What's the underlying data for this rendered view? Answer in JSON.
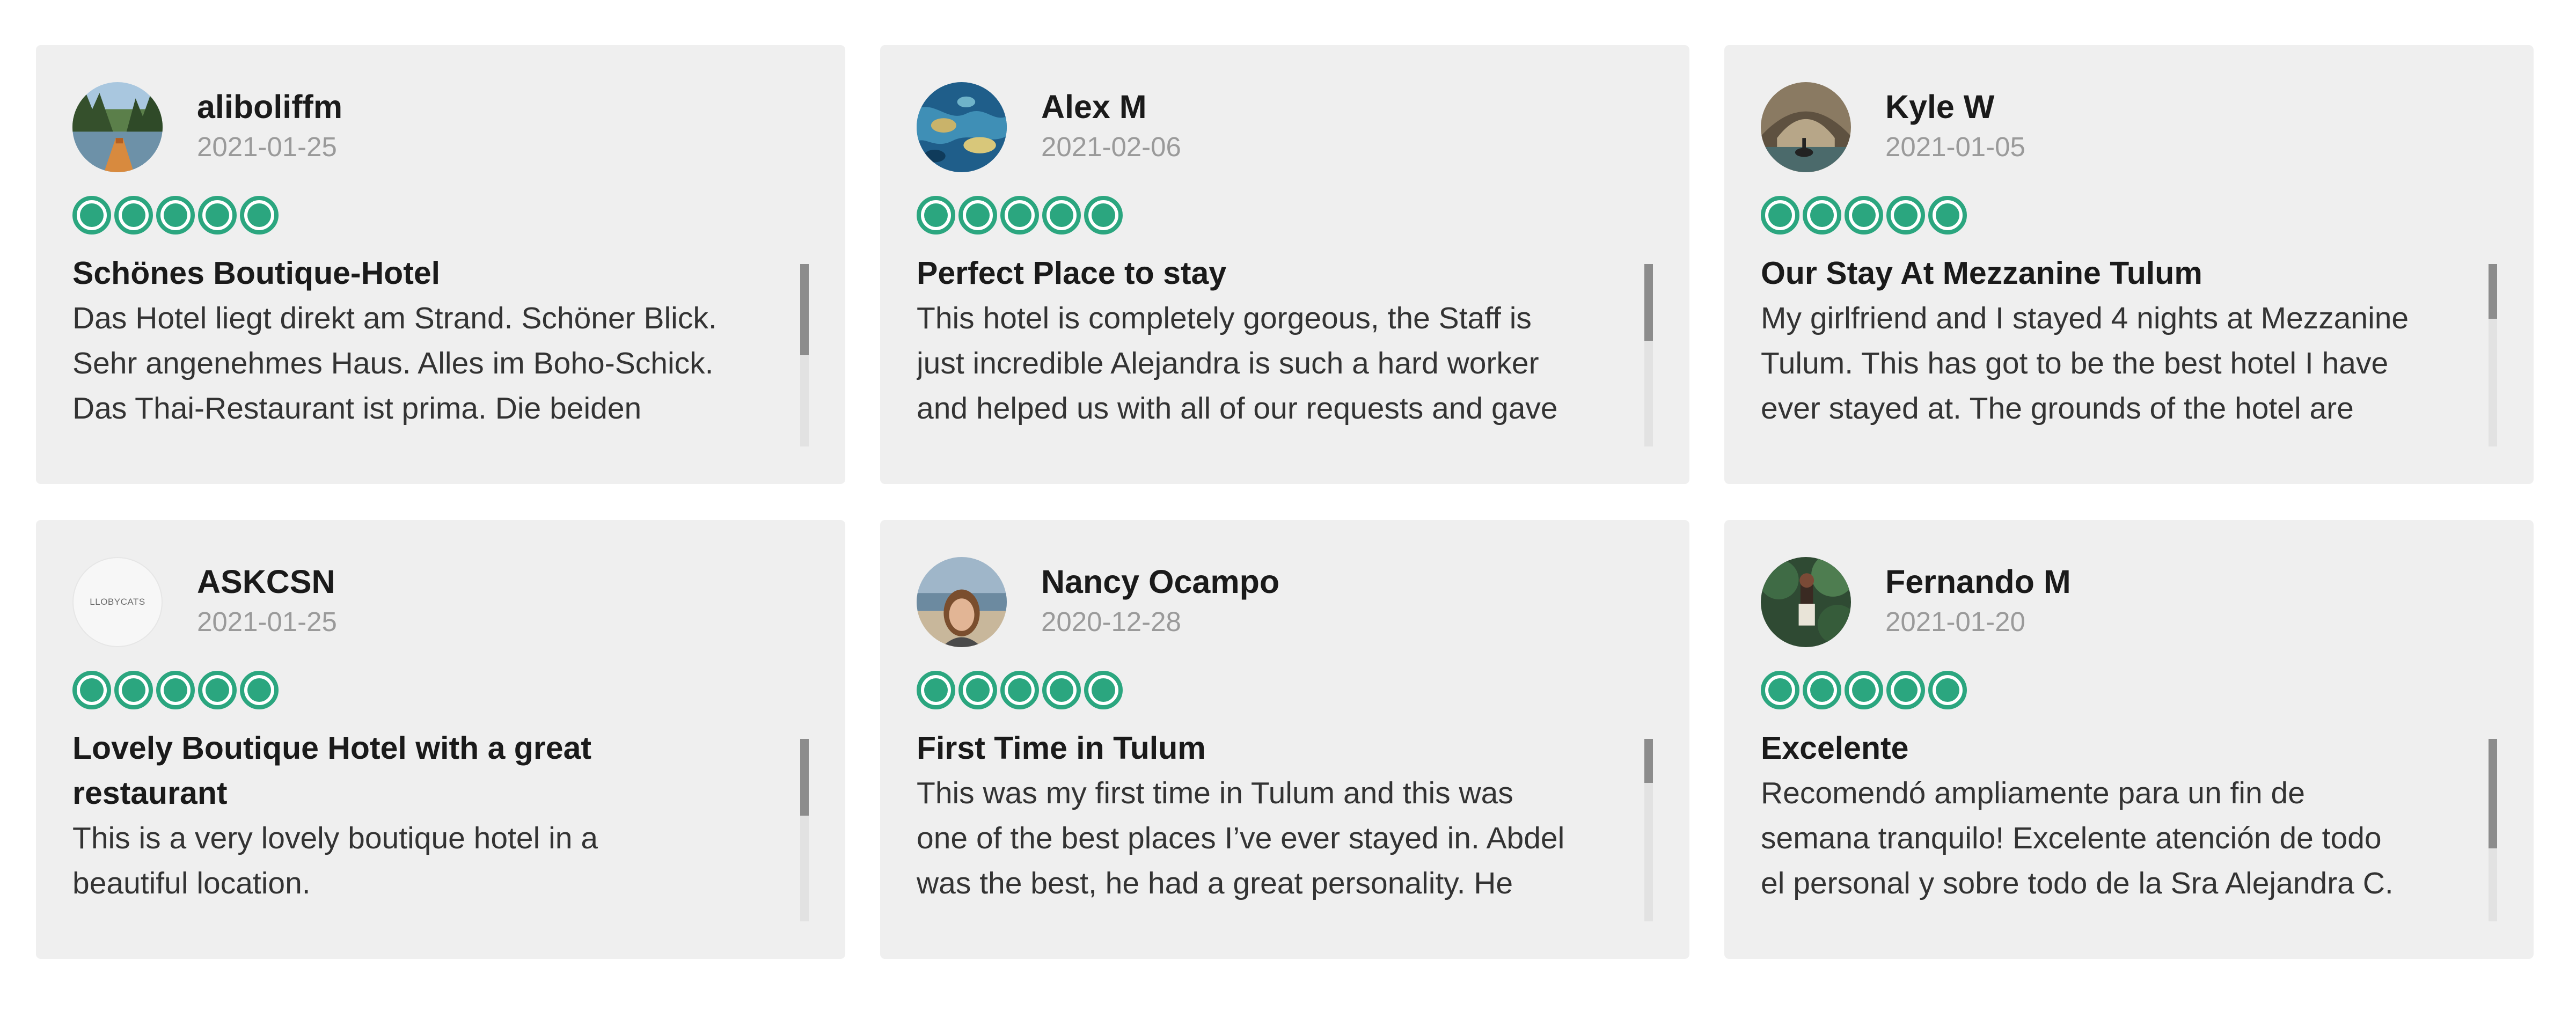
{
  "colors": {
    "rating": "#2ba67f",
    "card_bg": "#efefef",
    "date": "#9a9a9a"
  },
  "reviews": [
    {
      "user": "aliboliffm",
      "date": "2021-01-25",
      "avatar": "lake-photo",
      "rating": 5,
      "title": "Schönes Boutique-Hotel",
      "text": "Das Hotel liegt direkt am Strand. Schöner Blick.\nSehr angenehmes Haus. Alles im Boho-Schick.\nDas Thai-Restaurant ist prima. Die beiden",
      "scroll_fraction": 0.5
    },
    {
      "user": "Alex M",
      "date": "2021-02-06",
      "avatar": "reef-photo",
      "rating": 5,
      "title": "Perfect Place to stay",
      "text": "This hotel is completely gorgeous, the Staff is\njust incredible Alejandra is such a hard worker\nand helped us with all of our requests and gave",
      "scroll_fraction": 0.42
    },
    {
      "user": "Kyle W",
      "date": "2021-01-05",
      "avatar": "city-photo",
      "rating": 5,
      "title": "Our Stay At Mezzanine Tulum",
      "text": "My girlfriend and I stayed 4 nights at Mezzanine\nTulum. This has got to be the best hotel I have\never stayed at. The grounds of the hotel are",
      "scroll_fraction": 0.3
    },
    {
      "user": "ASKCSN",
      "date": "2021-01-25",
      "avatar": "logo",
      "avatar_text": "LLOBYCATS",
      "rating": 5,
      "title": "Lovely Boutique Hotel with a great\nrestaurant",
      "text": "This is a very lovely boutique hotel in a\nbeautiful location.",
      "scroll_fraction": 0.42
    },
    {
      "user": "Nancy Ocampo",
      "date": "2020-12-28",
      "avatar": "portrait-photo",
      "rating": 5,
      "title": "First Time in Tulum",
      "text": "This was my first time in Tulum and this was\none of the best places I’ve ever stayed in. Abdel\nwas the best, he had a great personality. He",
      "scroll_fraction": 0.24
    },
    {
      "user": "Fernando M",
      "date": "2021-01-20",
      "avatar": "jungle-photo",
      "rating": 5,
      "title": "Excelente",
      "text": "Recomendó ampliamente para un fin de\nsemana tranquilo! Excelente atención de todo\nel personal y sobre todo de la Sra Alejandra C.",
      "scroll_fraction": 0.6
    }
  ]
}
